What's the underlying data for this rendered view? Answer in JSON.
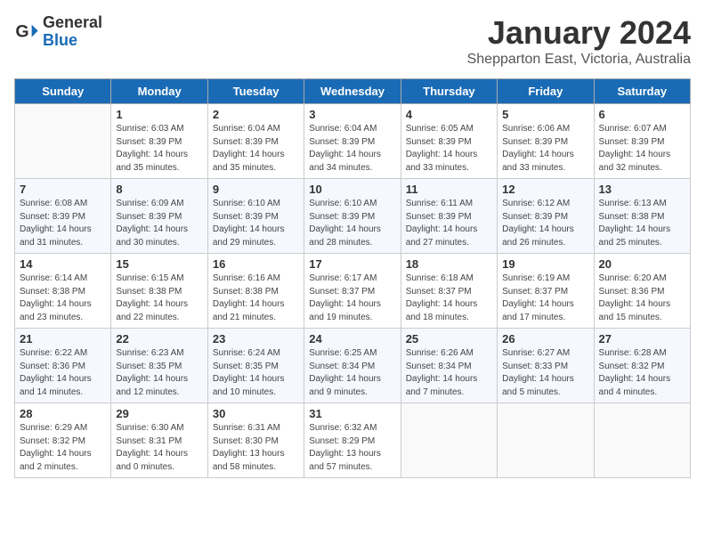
{
  "header": {
    "logo_general": "General",
    "logo_blue": "Blue",
    "month_title": "January 2024",
    "subtitle": "Shepparton East, Victoria, Australia"
  },
  "days_of_week": [
    "Sunday",
    "Monday",
    "Tuesday",
    "Wednesday",
    "Thursday",
    "Friday",
    "Saturday"
  ],
  "weeks": [
    [
      {
        "day": "",
        "info": ""
      },
      {
        "day": "1",
        "info": "Sunrise: 6:03 AM\nSunset: 8:39 PM\nDaylight: 14 hours\nand 35 minutes."
      },
      {
        "day": "2",
        "info": "Sunrise: 6:04 AM\nSunset: 8:39 PM\nDaylight: 14 hours\nand 35 minutes."
      },
      {
        "day": "3",
        "info": "Sunrise: 6:04 AM\nSunset: 8:39 PM\nDaylight: 14 hours\nand 34 minutes."
      },
      {
        "day": "4",
        "info": "Sunrise: 6:05 AM\nSunset: 8:39 PM\nDaylight: 14 hours\nand 33 minutes."
      },
      {
        "day": "5",
        "info": "Sunrise: 6:06 AM\nSunset: 8:39 PM\nDaylight: 14 hours\nand 33 minutes."
      },
      {
        "day": "6",
        "info": "Sunrise: 6:07 AM\nSunset: 8:39 PM\nDaylight: 14 hours\nand 32 minutes."
      }
    ],
    [
      {
        "day": "7",
        "info": "Sunrise: 6:08 AM\nSunset: 8:39 PM\nDaylight: 14 hours\nand 31 minutes."
      },
      {
        "day": "8",
        "info": "Sunrise: 6:09 AM\nSunset: 8:39 PM\nDaylight: 14 hours\nand 30 minutes."
      },
      {
        "day": "9",
        "info": "Sunrise: 6:10 AM\nSunset: 8:39 PM\nDaylight: 14 hours\nand 29 minutes."
      },
      {
        "day": "10",
        "info": "Sunrise: 6:10 AM\nSunset: 8:39 PM\nDaylight: 14 hours\nand 28 minutes."
      },
      {
        "day": "11",
        "info": "Sunrise: 6:11 AM\nSunset: 8:39 PM\nDaylight: 14 hours\nand 27 minutes."
      },
      {
        "day": "12",
        "info": "Sunrise: 6:12 AM\nSunset: 8:39 PM\nDaylight: 14 hours\nand 26 minutes."
      },
      {
        "day": "13",
        "info": "Sunrise: 6:13 AM\nSunset: 8:38 PM\nDaylight: 14 hours\nand 25 minutes."
      }
    ],
    [
      {
        "day": "14",
        "info": "Sunrise: 6:14 AM\nSunset: 8:38 PM\nDaylight: 14 hours\nand 23 minutes."
      },
      {
        "day": "15",
        "info": "Sunrise: 6:15 AM\nSunset: 8:38 PM\nDaylight: 14 hours\nand 22 minutes."
      },
      {
        "day": "16",
        "info": "Sunrise: 6:16 AM\nSunset: 8:38 PM\nDaylight: 14 hours\nand 21 minutes."
      },
      {
        "day": "17",
        "info": "Sunrise: 6:17 AM\nSunset: 8:37 PM\nDaylight: 14 hours\nand 19 minutes."
      },
      {
        "day": "18",
        "info": "Sunrise: 6:18 AM\nSunset: 8:37 PM\nDaylight: 14 hours\nand 18 minutes."
      },
      {
        "day": "19",
        "info": "Sunrise: 6:19 AM\nSunset: 8:37 PM\nDaylight: 14 hours\nand 17 minutes."
      },
      {
        "day": "20",
        "info": "Sunrise: 6:20 AM\nSunset: 8:36 PM\nDaylight: 14 hours\nand 15 minutes."
      }
    ],
    [
      {
        "day": "21",
        "info": "Sunrise: 6:22 AM\nSunset: 8:36 PM\nDaylight: 14 hours\nand 14 minutes."
      },
      {
        "day": "22",
        "info": "Sunrise: 6:23 AM\nSunset: 8:35 PM\nDaylight: 14 hours\nand 12 minutes."
      },
      {
        "day": "23",
        "info": "Sunrise: 6:24 AM\nSunset: 8:35 PM\nDaylight: 14 hours\nand 10 minutes."
      },
      {
        "day": "24",
        "info": "Sunrise: 6:25 AM\nSunset: 8:34 PM\nDaylight: 14 hours\nand 9 minutes."
      },
      {
        "day": "25",
        "info": "Sunrise: 6:26 AM\nSunset: 8:34 PM\nDaylight: 14 hours\nand 7 minutes."
      },
      {
        "day": "26",
        "info": "Sunrise: 6:27 AM\nSunset: 8:33 PM\nDaylight: 14 hours\nand 5 minutes."
      },
      {
        "day": "27",
        "info": "Sunrise: 6:28 AM\nSunset: 8:32 PM\nDaylight: 14 hours\nand 4 minutes."
      }
    ],
    [
      {
        "day": "28",
        "info": "Sunrise: 6:29 AM\nSunset: 8:32 PM\nDaylight: 14 hours\nand 2 minutes."
      },
      {
        "day": "29",
        "info": "Sunrise: 6:30 AM\nSunset: 8:31 PM\nDaylight: 14 hours\nand 0 minutes."
      },
      {
        "day": "30",
        "info": "Sunrise: 6:31 AM\nSunset: 8:30 PM\nDaylight: 13 hours\nand 58 minutes."
      },
      {
        "day": "31",
        "info": "Sunrise: 6:32 AM\nSunset: 8:29 PM\nDaylight: 13 hours\nand 57 minutes."
      },
      {
        "day": "",
        "info": ""
      },
      {
        "day": "",
        "info": ""
      },
      {
        "day": "",
        "info": ""
      }
    ]
  ]
}
